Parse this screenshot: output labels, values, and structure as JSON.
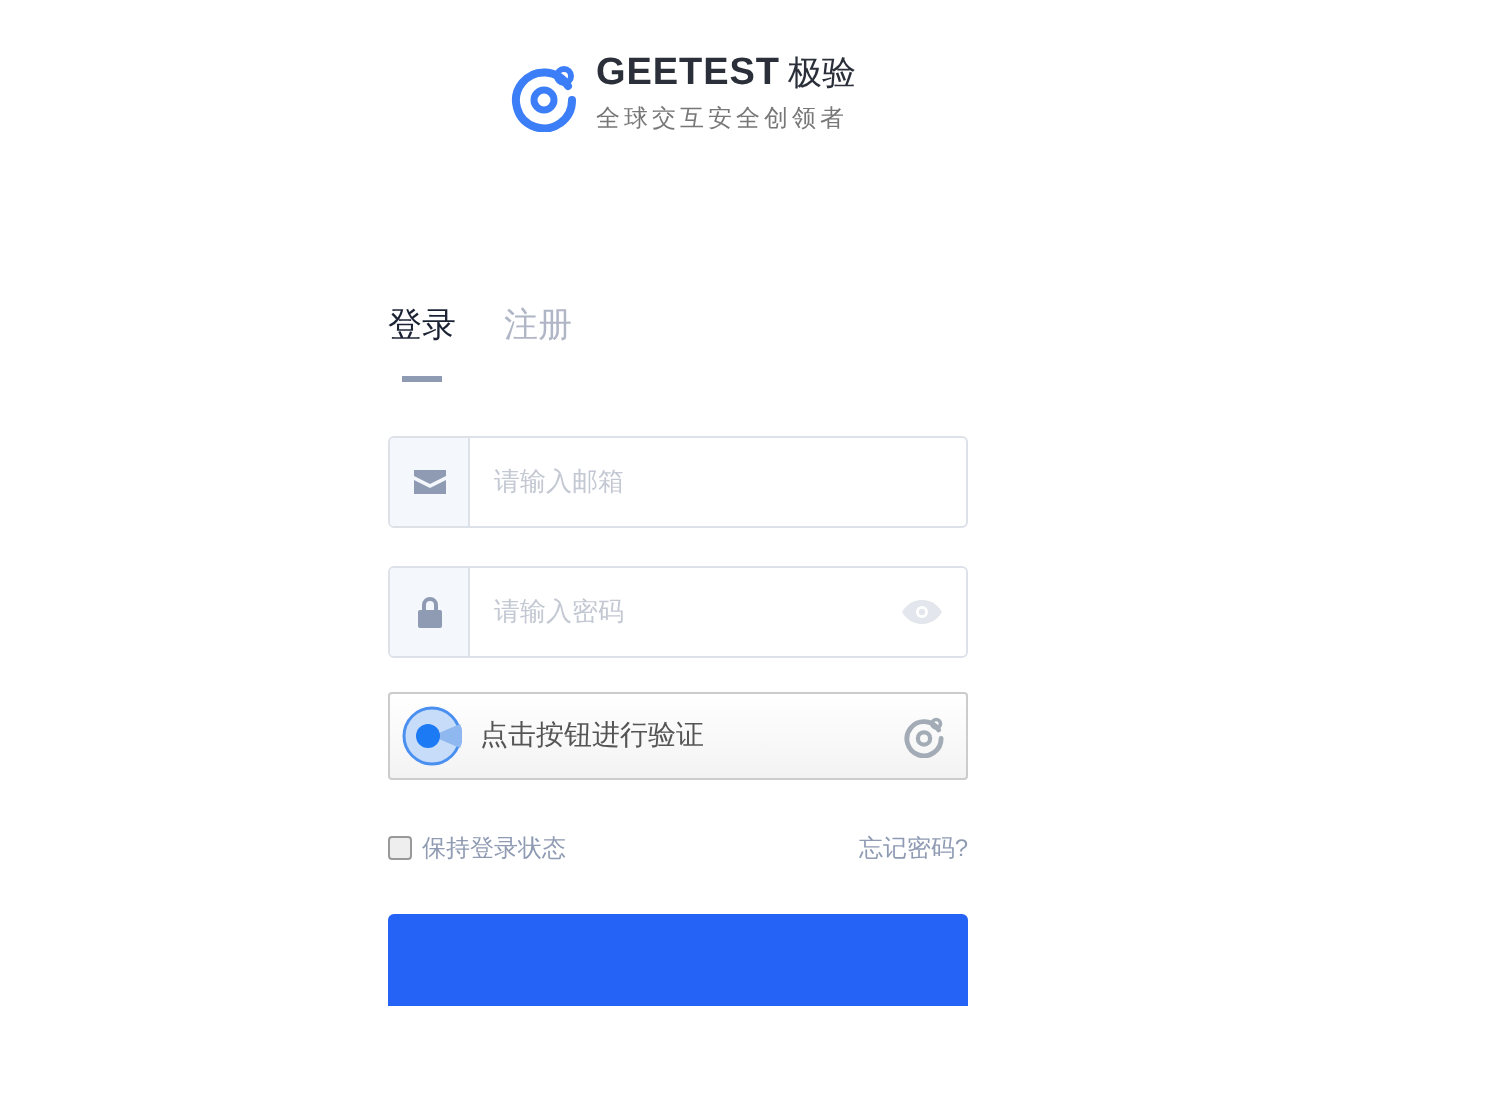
{
  "logo": {
    "brand": "GEETEST",
    "brand_cn": "极验",
    "tagline": "全球交互安全创领者"
  },
  "tabs": [
    {
      "label": "登录",
      "selected": true
    },
    {
      "label": "注册",
      "selected": false
    }
  ],
  "fields": [
    {
      "kind": "email",
      "placeholder": "请输入邮箱"
    },
    {
      "kind": "password",
      "placeholder": "请输入密码"
    }
  ],
  "captcha": {
    "label": "点击按钮进行验证"
  },
  "remember": {
    "label": "保持登录状态",
    "checked": false
  },
  "forgot": "忘记密码?"
}
